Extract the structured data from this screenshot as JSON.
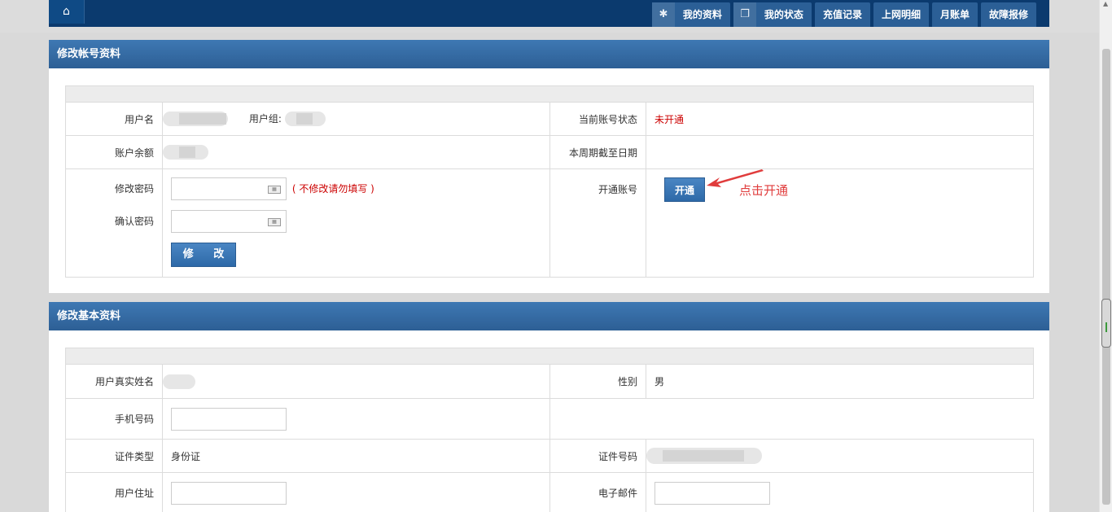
{
  "nav": {
    "items": [
      {
        "label": "我的资料",
        "icon": "gear-icon"
      },
      {
        "label": "我的状态",
        "icon": "windows-icon"
      },
      {
        "label": "充值记录"
      },
      {
        "label": "上网明细"
      },
      {
        "label": "月账单"
      },
      {
        "label": "故障报修"
      }
    ]
  },
  "account": {
    "title": "修改帐号资料",
    "username_label": "用户名",
    "usergroup_label": "用户组:",
    "status_label": "当前账号状态",
    "status_value": "未开通",
    "balance_label": "账户余额",
    "period_end_label": "本周期截至日期",
    "password_label": "修改密码",
    "password_hint": "( 不修改请勿填写 )",
    "confirm_label": "确认密码",
    "modify_button": "修 改",
    "open_account_label": "开通账号",
    "open_button": "开通",
    "annotation": "点击开通"
  },
  "basic": {
    "title": "修改基本资料",
    "realname_label": "用户真实姓名",
    "gender_label": "性别",
    "gender_value": "男",
    "phone_label": "手机号码",
    "id_type_label": "证件类型",
    "id_type_value": "身份证",
    "id_number_label": "证件号码",
    "address_label": "用户住址",
    "email_label": "电子邮件"
  },
  "colors": {
    "header_blue": "#2d5f95",
    "status_red": "#cc0000",
    "annotation_red": "#e03c3c"
  }
}
